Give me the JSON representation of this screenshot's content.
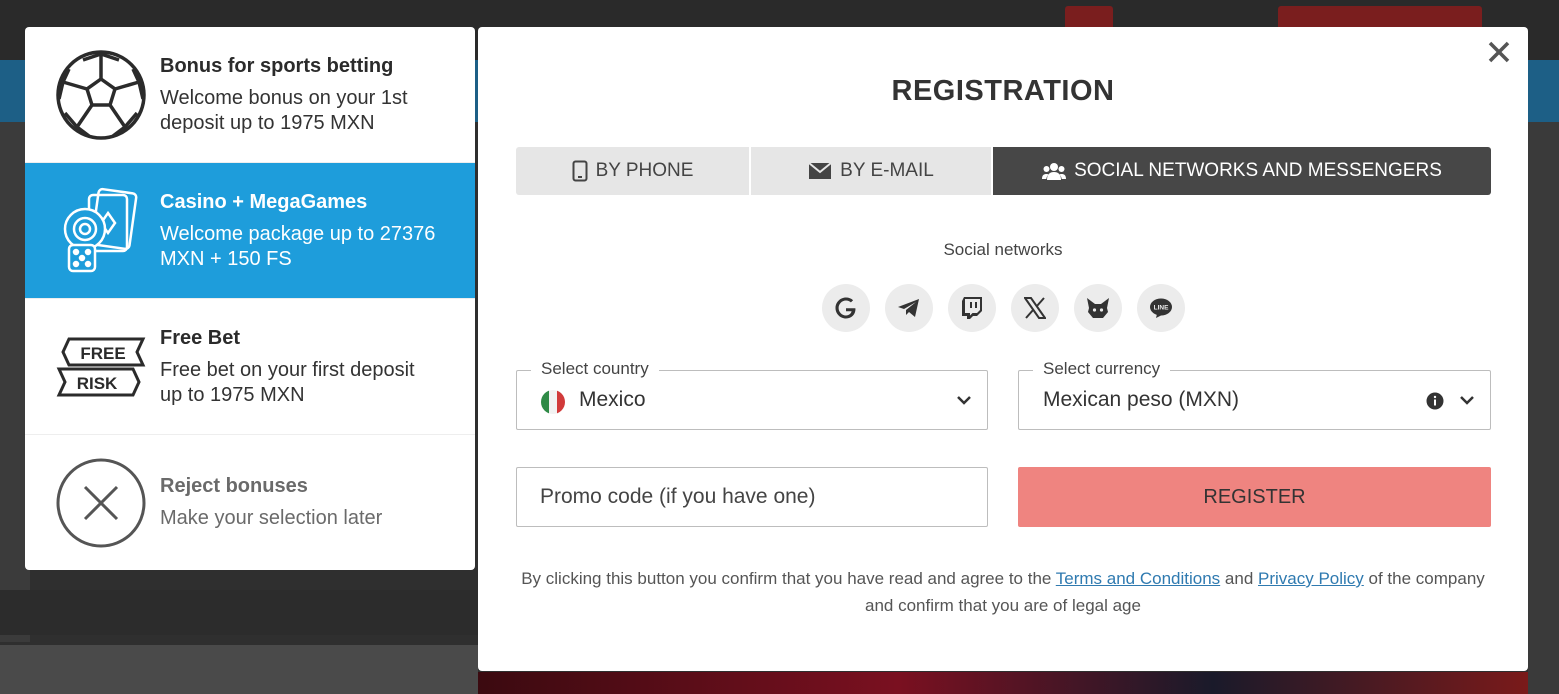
{
  "bonuses": [
    {
      "title": "Bonus for sports betting",
      "desc": "Welcome bonus on your 1st deposit up to 1975 MXN",
      "icon": "soccer-ball-icon"
    },
    {
      "title": "Casino + MegaGames",
      "desc": "Welcome package up to 27376 MXN + 150 FS",
      "icon": "casino-chips-cards-icon"
    },
    {
      "title": "Free Bet",
      "desc": "Free bet on your first deposit up to 1975 MXN",
      "icon": "free-risk-ticket-icon",
      "badge_top": "FREE",
      "badge_bottom": "RISK"
    },
    {
      "title": "Reject bonuses",
      "desc": "Make your selection later",
      "icon": "close-circle-icon"
    }
  ],
  "modal": {
    "title": "REGISTRATION",
    "tabs": [
      "BY PHONE",
      "BY E-MAIL",
      "SOCIAL NETWORKS AND MESSENGERS"
    ],
    "active_tab": 2,
    "social_label": "Social networks",
    "social_networks": [
      "google-icon",
      "telegram-icon",
      "twitch-icon",
      "x-icon",
      "metamask-icon",
      "line-icon"
    ],
    "line_text": "LINE",
    "country_label": "Select country",
    "country_value": "Mexico",
    "currency_label": "Select currency",
    "currency_value": "Mexican peso (MXN)",
    "promo_placeholder": "Promo code (if you have one)",
    "register_label": "REGISTER",
    "legal": {
      "before": "By clicking this button you confirm that you have read and agree to the ",
      "terms": "Terms and Conditions",
      "and": " and ",
      "privacy": "Privacy Policy",
      "after": " of the company and confirm that you are of legal age"
    }
  },
  "colors": {
    "accent_blue": "#1e9ddb",
    "register_button": "#ef8480",
    "active_tab": "#474747",
    "link": "#2f7ab0"
  }
}
